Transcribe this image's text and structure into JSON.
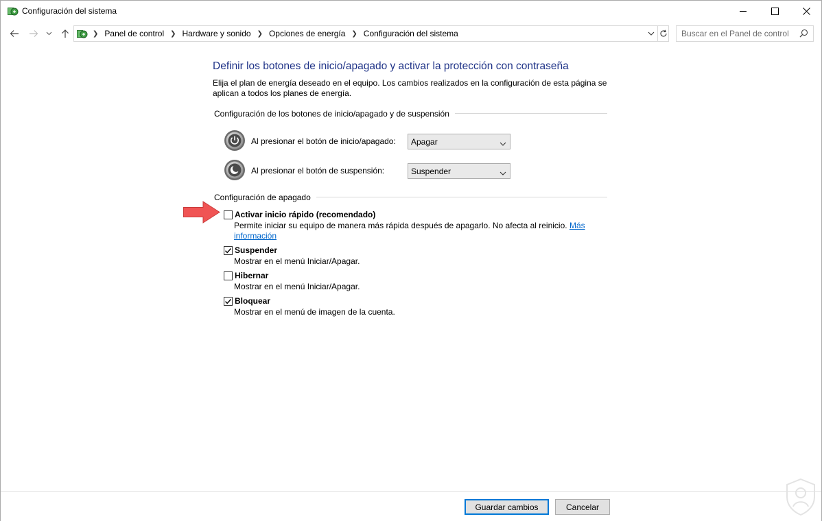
{
  "window": {
    "title": "Configuración del sistema",
    "icon": "power-options-icon"
  },
  "address_bar": {
    "breadcrumbs": [
      "Panel de control",
      "Hardware y sonido",
      "Opciones de energía",
      "Configuración del sistema"
    ]
  },
  "search": {
    "placeholder": "Buscar en el Panel de control"
  },
  "main": {
    "heading": "Definir los botones de inicio/apagado y activar la protección con contraseña",
    "intro": "Elija el plan de energía deseado en el equipo. Los cambios realizados en la configuración de esta página se aplican a todos los planes de energía.",
    "power_section": {
      "title": "Configuración de los botones de inicio/apagado y de suspensión",
      "rows": [
        {
          "label": "Al presionar el botón de inicio/apagado:",
          "value": "Apagar",
          "icon": "power-button-icon"
        },
        {
          "label": "Al presionar el botón de suspensión:",
          "value": "Suspender",
          "icon": "sleep-button-icon"
        }
      ]
    },
    "shutdown_section": {
      "title": "Configuración de apagado",
      "options": [
        {
          "label": "Activar inicio rápido (recomendado)",
          "checked": false,
          "description": "Permite iniciar su equipo de manera más rápida después de apagarlo. No afecta al reinicio. ",
          "link": "Más información"
        },
        {
          "label": "Suspender",
          "checked": true,
          "description": "Mostrar en el menú Iniciar/Apagar."
        },
        {
          "label": "Hibernar",
          "checked": false,
          "description": "Mostrar en el menú Iniciar/Apagar."
        },
        {
          "label": "Bloquear",
          "checked": true,
          "description": "Mostrar en el menú de imagen de la cuenta."
        }
      ]
    }
  },
  "footer": {
    "save_label": "Guardar cambios",
    "cancel_label": "Cancelar"
  },
  "colors": {
    "heading": "#1e3287",
    "link": "#0066cc",
    "annotation_arrow": "#f05454"
  }
}
